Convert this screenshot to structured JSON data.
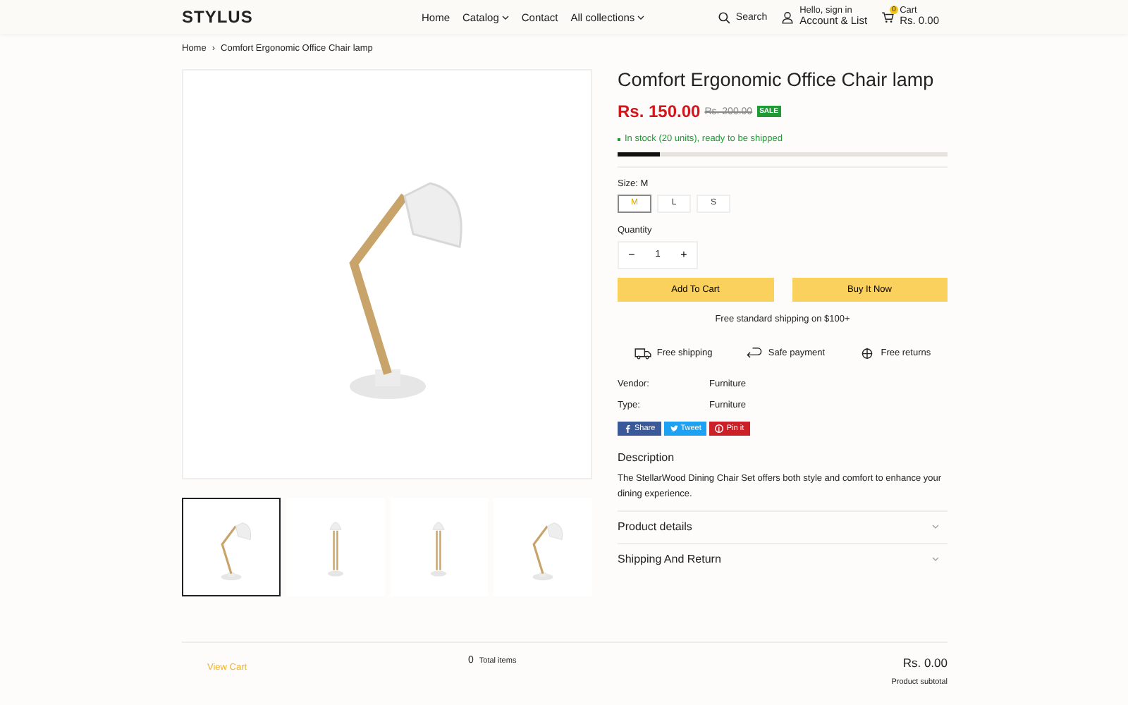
{
  "header": {
    "logo": "STYLUS",
    "nav": [
      {
        "label": "Home",
        "dropdown": false
      },
      {
        "label": "Catalog",
        "dropdown": true
      },
      {
        "label": "Contact",
        "dropdown": false
      },
      {
        "label": "All collections",
        "dropdown": true
      }
    ],
    "search": "Search",
    "account": {
      "line1": "Hello, sign in",
      "line2": "Account & List"
    },
    "cart": {
      "count": "0",
      "label": "Cart",
      "total": "Rs. 0.00"
    }
  },
  "breadcrumb": {
    "separator": "›",
    "items": [
      "Home",
      "Comfort Ergonomic Office Chair lamp"
    ]
  },
  "gallery": {
    "thumbnails": [
      {
        "kind": "side",
        "selected": true
      },
      {
        "kind": "front",
        "selected": false
      },
      {
        "kind": "front",
        "selected": false
      },
      {
        "kind": "side",
        "selected": false
      }
    ]
  },
  "product": {
    "title": "Comfort Ergonomic Office Chair lamp",
    "price": "Rs. 150.00",
    "compare_price": "Rs. 200.00",
    "badge": "SALE",
    "stock": "In stock (20 units), ready to be shipped",
    "stock_level": {
      "level": 0.13
    },
    "size_label": "Size: M",
    "sizes": [
      {
        "label": "M",
        "selected": true
      },
      {
        "label": "L",
        "selected": false
      },
      {
        "label": "S",
        "selected": false
      }
    ],
    "quantity_label": "Quantity",
    "quantity": {
      "minus": "−",
      "value": "1",
      "plus": "+"
    },
    "buttons": [
      "Add To Cart",
      "Buy It Now"
    ],
    "shipping_note": "Free standard shipping on $100+",
    "features": [
      {
        "kind": "truck",
        "label": "Free shipping"
      },
      {
        "kind": "return",
        "label": "Safe payment"
      },
      {
        "kind": "globe",
        "label": "Free returns"
      }
    ],
    "meta": [
      {
        "key": "Vendor:",
        "value": "Furniture"
      },
      {
        "key": "Type:",
        "value": "Furniture"
      }
    ],
    "share": [
      {
        "kind": "facebook",
        "label": "Share",
        "color": "#3b5998"
      },
      {
        "kind": "twitter",
        "label": "Tweet",
        "color": "#1da1f2"
      },
      {
        "kind": "pinterest",
        "label": "Pin it",
        "color": "#cb2027"
      }
    ],
    "description_title": "Description",
    "description": "The StellarWood Dining Chair Set offers both style and comfort to enhance your dining experience.",
    "accordions": [
      {
        "title": "Product details",
        "expanded": false
      },
      {
        "title": "Shipping And Return",
        "expanded": false
      }
    ]
  },
  "cart_bar": {
    "view_cart": "View Cart",
    "count": "0",
    "count_label": "Total items",
    "subtotal": "Rs. 0.00",
    "subtotal_label": "Product subtotal"
  }
}
